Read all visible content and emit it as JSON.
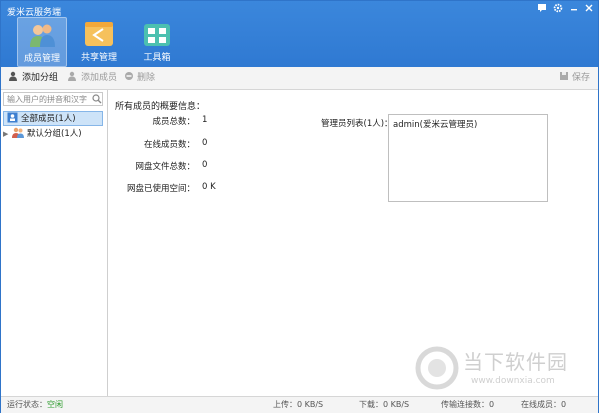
{
  "window": {
    "title": "爱米云服务端"
  },
  "nav": [
    {
      "label": "成员管理",
      "active": true
    },
    {
      "label": "共享管理",
      "active": false
    },
    {
      "label": "工具箱",
      "active": false
    }
  ],
  "toolbar": {
    "add_group": "添加分组",
    "add_member": "添加成员",
    "delete": "删除",
    "save": "保存"
  },
  "sidebar": {
    "search_placeholder": "输入用户的拼音和汉字",
    "items": [
      {
        "label": "全部成员(1人)"
      },
      {
        "label": "默认分组(1人)"
      }
    ]
  },
  "main": {
    "heading": "所有成员的概要信息：",
    "stats": [
      {
        "label": "成员总数：",
        "value": "1"
      },
      {
        "label": "在线成员数：",
        "value": "0"
      },
      {
        "label": "网盘文件总数：",
        "value": "0"
      },
      {
        "label": "网盘已使用空间：",
        "value": "0 K"
      }
    ],
    "admin_label": "管理员列表(1人)：",
    "admin_entries": [
      "admin(爱米云管理员)"
    ]
  },
  "status": {
    "run_label": "运行状态：",
    "run_value": "空闲",
    "upload": "上传：0 KB/S",
    "download": "下载：0 KB/S",
    "connections": "传输连接数：0",
    "online": "在线成员：0"
  },
  "watermark": {
    "text": "当下软件园",
    "url": "www.downxia.com"
  }
}
